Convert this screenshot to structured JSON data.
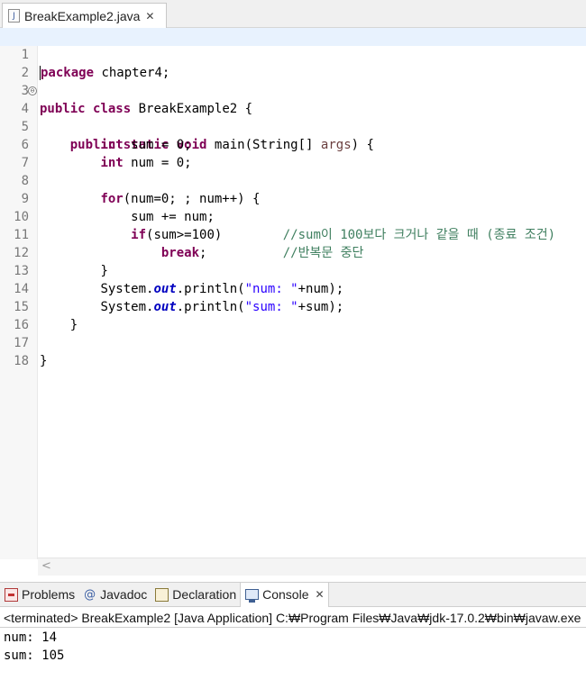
{
  "editor_tab": {
    "title": "BreakExample2.java",
    "icon": "java-file-icon",
    "close": "✕"
  },
  "code_lines": [
    "package chapter4;",
    "",
    "public class BreakExample2 {",
    "    public static void main(String[] args) {",
    "        int sum = 0;",
    "        int num = 0;",
    "",
    "        for(num=0; ; num++) {",
    "            sum += num;",
    "            if(sum>=100)        //sum이 100보다 크거나 같을 때 (종료 조건)",
    "                break;          //반복문 중단",
    "        }",
    "        System.out.println(\"num: \"+num);",
    "        System.out.println(\"sum: \"+sum);",
    "    }",
    "",
    "}",
    ""
  ],
  "line_numbers": [
    "1",
    "2",
    "3",
    "4",
    "5",
    "6",
    "7",
    "8",
    "9",
    "10",
    "11",
    "12",
    "13",
    "14",
    "15",
    "16",
    "17",
    "18"
  ],
  "tokens": {
    "package": "package",
    "chapter4": " chapter4;",
    "public": "public",
    "class": "class",
    "class_name": " BreakExample2 {",
    "static": "static",
    "void": "void",
    "main_sig": " main(String[] ",
    "args": "args",
    "main_end": ") {",
    "int": "int",
    "sum_decl": " sum = 0;",
    "num_decl": " num = 0;",
    "for": "for",
    "for_body": "(num=0; ; num++) {",
    "sum_add": "sum += num;",
    "if": "if",
    "if_cond": "(sum>=100)",
    "comment1": "//sum이 100보다 크거나 같을 때 (종료 조건)",
    "break": "break",
    "break_semi": ";",
    "comment2": "//반복문 중단",
    "close_brace": "}",
    "system": "System.",
    "out": "out",
    "println": ".println(",
    "str_num": "\"num: \"",
    "plus_num": "+num);",
    "str_sum": "\"sum: \"",
    "plus_sum": "+sum);"
  },
  "panel_tabs": [
    {
      "label": "Problems",
      "icon": "problems-icon"
    },
    {
      "label": "Javadoc",
      "icon": "javadoc-icon",
      "glyph": "@"
    },
    {
      "label": "Declaration",
      "icon": "declaration-icon"
    },
    {
      "label": "Console",
      "icon": "console-icon",
      "close": "✕",
      "active": true
    }
  ],
  "console": {
    "status": "<terminated> BreakExample2 [Java Application] C:₩Program Files₩Java₩jdk-17.0.2₩bin₩javaw.exe",
    "output": [
      "num: 14",
      "sum: 105"
    ]
  },
  "colors": {
    "keyword": "#7f0055",
    "string": "#2a00ff",
    "comment": "#3f7f5f",
    "static_field": "#0000c0",
    "current_line": "#e8f2fe"
  },
  "scroll_left_arrow": "<",
  "fold_glyph": "⊖"
}
